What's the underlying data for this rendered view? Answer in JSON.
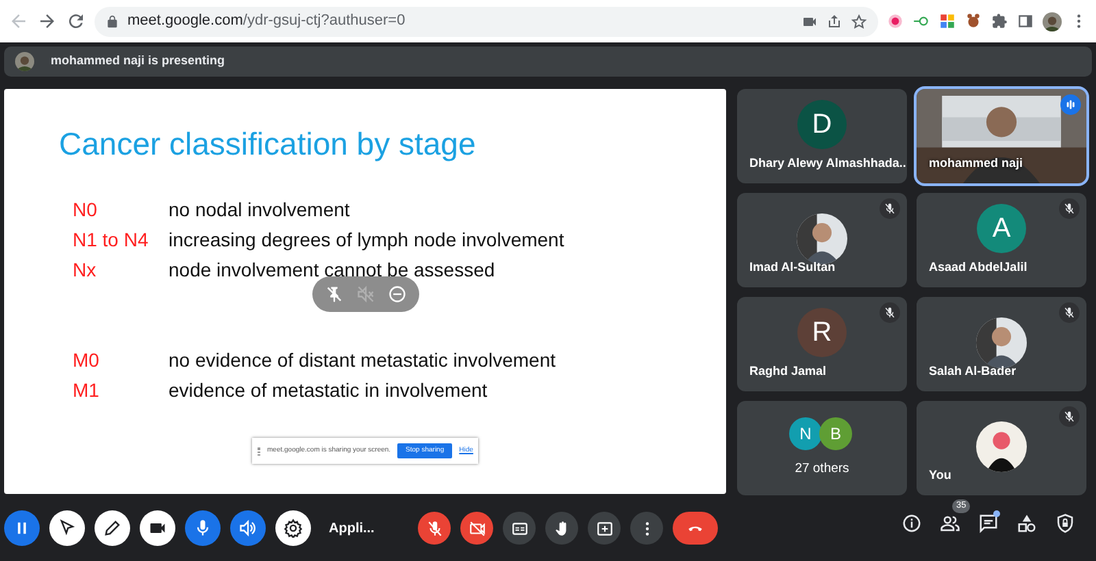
{
  "browser": {
    "url_host": "meet.google.com",
    "url_path": "/ydr-gsuj-ctj?authuser=0",
    "nav": [
      {
        "kind": "back"
      },
      {
        "kind": "forward"
      },
      {
        "kind": "reload"
      }
    ],
    "tools": [
      {
        "kind": "camera"
      },
      {
        "kind": "share"
      },
      {
        "kind": "star"
      }
    ],
    "extensions": [
      {
        "kind": "record"
      },
      {
        "kind": "key"
      },
      {
        "kind": "tiles"
      },
      {
        "kind": "animal"
      },
      {
        "kind": "puzzle"
      },
      {
        "kind": "sidebar"
      },
      {
        "kind": "profile"
      },
      {
        "kind": "menu"
      }
    ]
  },
  "banner": {
    "text": "mohammed naji is presenting"
  },
  "slide": {
    "title": "Cancer classification by stage",
    "groups": [
      [
        {
          "code": "N0",
          "text": "no nodal involvement"
        },
        {
          "code": "N1 to N4",
          "text": "increasing degrees of lymph node involvement"
        },
        {
          "code": "Nx",
          "text": "node involvement cannot be assessed"
        }
      ],
      [
        {
          "code": "M0",
          "text": "no evidence of distant metastatic involvement"
        },
        {
          "code": "M1",
          "text": "evidence of metastatic in involvement"
        }
      ]
    ],
    "overlay": [
      {
        "kind": "unpin"
      },
      {
        "kind": "mute"
      },
      {
        "kind": "remove"
      }
    ],
    "share_bar": {
      "text": "meet.google.com is sharing your screen.",
      "button": "Stop sharing",
      "link": "Hide"
    }
  },
  "tiles": [
    {
      "kind": "initial",
      "name": "Dhary Alewy Almashhada...",
      "initial": "D",
      "color": "#0b5345",
      "muted": false,
      "speaking": false
    },
    {
      "kind": "video",
      "name": "mohammed naji",
      "muted": false,
      "speaking": true
    },
    {
      "name": "Imad Al-Sultan",
      "muted": true,
      "speaking": false
    },
    {
      "kind": "initial",
      "name": "Asaad AbdelJalil",
      "initial": "A",
      "color": "#138a7a",
      "muted": true,
      "speaking": false
    },
    {
      "kind": "initial",
      "name": "Raghd Jamal",
      "initial": "R",
      "color": "#5d4037",
      "muted": true,
      "speaking": false
    },
    {
      "name": "Salah Al-Bader",
      "muted": true,
      "speaking": false
    },
    {
      "kind": "others",
      "name": "27 others",
      "avatars": [
        {
          "initial": "N",
          "color": "#129eaf"
        },
        {
          "initial": "B",
          "color": "#5f9e34"
        }
      ],
      "muted": false,
      "speaking": false
    },
    {
      "name": "You",
      "muted": true,
      "speaking": false
    }
  ],
  "present_controls": {
    "buttons": [
      {
        "kind": "pause",
        "color": "#1a73e8"
      },
      {
        "kind": "pointer",
        "color": "#ffffff"
      },
      {
        "kind": "pen",
        "color": "#ffffff"
      },
      {
        "kind": "camera",
        "color": "#ffffff"
      },
      {
        "kind": "mic",
        "color": "#1a73e8"
      },
      {
        "kind": "speaker",
        "color": "#1a73e8"
      },
      {
        "kind": "gear",
        "color": "#ffffff"
      }
    ],
    "caption": "Appli..."
  },
  "call_controls": [
    {
      "kind": "mic",
      "on": false
    },
    {
      "kind": "camera",
      "on": false
    },
    {
      "kind": "captions",
      "on": false
    },
    {
      "kind": "hand",
      "on": false
    },
    {
      "kind": "present",
      "on": false
    },
    {
      "kind": "more",
      "on": false
    },
    {
      "kind": "end"
    }
  ],
  "side_controls": [
    {
      "kind": "info"
    },
    {
      "kind": "people",
      "badge": "35"
    },
    {
      "kind": "chat",
      "unread": true
    },
    {
      "kind": "activities"
    },
    {
      "kind": "safety"
    }
  ]
}
